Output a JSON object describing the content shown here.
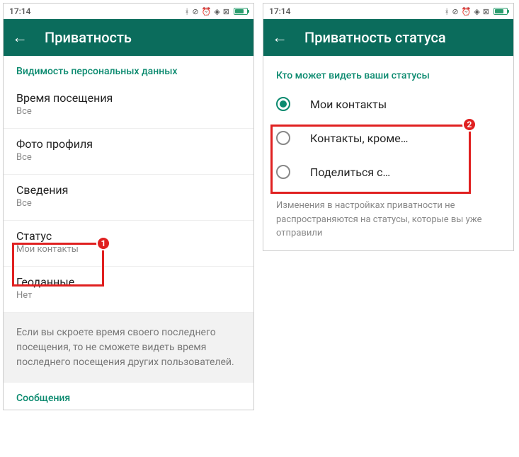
{
  "status_bar": {
    "time": "17:14",
    "icons": [
      "bluetooth",
      "dnd",
      "alarm",
      "wifi",
      "box",
      "battery"
    ]
  },
  "phone1": {
    "title": "Приватность",
    "section_header": "Видимость персональных данных",
    "items": [
      {
        "label": "Время посещения",
        "value": "Все"
      },
      {
        "label": "Фото профиля",
        "value": "Все"
      },
      {
        "label": "Сведения",
        "value": "Все"
      },
      {
        "label": "Статус",
        "value": "Мои контакты"
      },
      {
        "label": "Геоданные",
        "value": "Нет"
      }
    ],
    "info": "Если вы скроете время своего последнего посещения, то не сможете видеть время последнего посещения других пользователей.",
    "footer_link": "Сообщения",
    "badge": "1"
  },
  "phone2": {
    "title": "Приватность статуса",
    "section_header": "Кто может видеть ваши статусы",
    "options": [
      {
        "label": "Мои контакты",
        "selected": true
      },
      {
        "label": "Контакты, кроме…",
        "selected": false
      },
      {
        "label": "Поделиться с…",
        "selected": false
      }
    ],
    "note": "Изменения в настройках приватности не распространяются на статусы, которые вы уже отправили",
    "badge": "2"
  }
}
